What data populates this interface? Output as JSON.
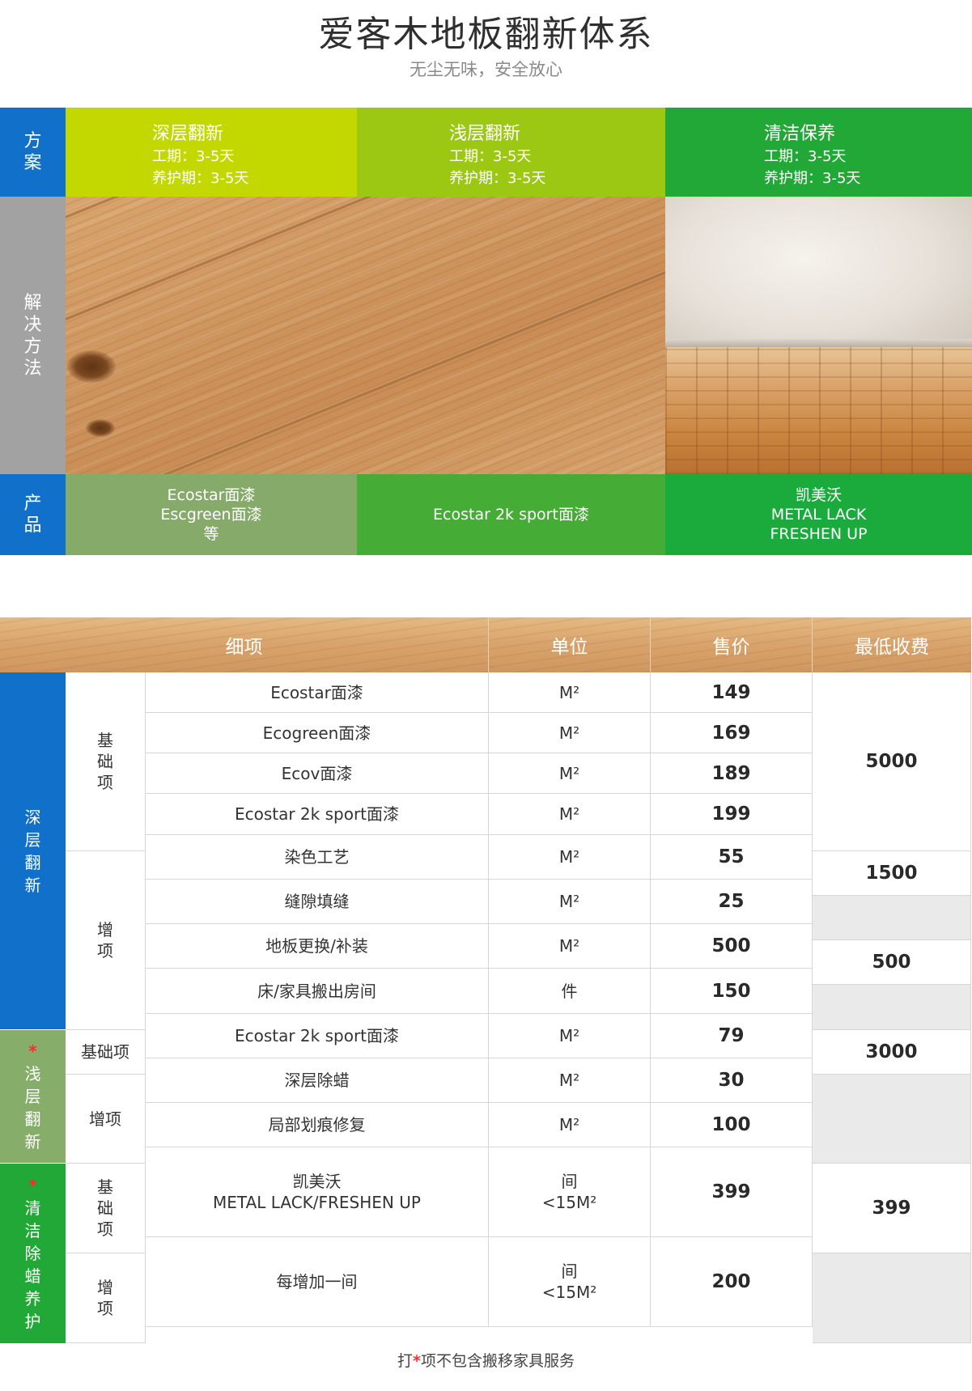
{
  "header": {
    "title": "爱客木地板翻新体系",
    "subtitle": "无尘无味，安全放心"
  },
  "scheme": {
    "labels": {
      "plan": "方案",
      "method": "解决方法",
      "product": "产品"
    },
    "plans": [
      {
        "name": "深层翻新",
        "period": "工期：3-5天",
        "care": "养护期：3-5天",
        "color": "#c2d800"
      },
      {
        "name": "浅层翻新",
        "period": "工期：3-5天",
        "care": "养护期：3-5天",
        "color": "#9cc713"
      },
      {
        "name": "清洁保养",
        "period": "工期：3-5天",
        "care": "养护期：3-5天",
        "color": "#21a836"
      }
    ],
    "products": [
      {
        "lines": [
          "Ecostar面漆",
          "Escgreen面漆",
          "等"
        ],
        "color": "#86aa6a"
      },
      {
        "lines": [
          "Ecostar 2k sport面漆"
        ],
        "color": "#45ac35"
      },
      {
        "lines": [
          "凯美沃",
          "METAL LACK",
          "FRESHEN UP"
        ],
        "color": "#1bab3c"
      }
    ],
    "label_colors": {
      "plan": "#1170c9",
      "method": "#a2a2a2",
      "product": "#1170c9"
    }
  },
  "table": {
    "headers": [
      "细项",
      "单位",
      "售价",
      "最低收费"
    ],
    "groups": [
      {
        "label": "深层翻新",
        "starred": false,
        "color": "#1170c9"
      },
      {
        "label": "浅层翻新",
        "starred": true,
        "color": "#87ad6a"
      },
      {
        "label": "清洁除蜡养护",
        "starred": true,
        "color": "#21a836"
      }
    ],
    "star": "*",
    "subgroups": {
      "deep_base": "基础项",
      "deep_add": "增项",
      "shallow_base": "基础项",
      "shallow_add": "增项",
      "clean_base": "基础项",
      "clean_add": "增项"
    },
    "rows": [
      {
        "item": "Ecostar面漆",
        "unit": "M²",
        "price": "149"
      },
      {
        "item": "Ecogreen面漆",
        "unit": "M²",
        "price": "169"
      },
      {
        "item": "Ecov面漆",
        "unit": "M²",
        "price": "189"
      },
      {
        "item": "Ecostar 2k sport面漆",
        "unit": "M²",
        "price": "199"
      },
      {
        "item": "染色工艺",
        "unit": "M²",
        "price": "55"
      },
      {
        "item": "缝隙填缝",
        "unit": "M²",
        "price": "25"
      },
      {
        "item": "地板更换/补装",
        "unit": "M²",
        "price": "500"
      },
      {
        "item": "床/家具搬出房间",
        "unit": "件",
        "price": "150"
      },
      {
        "item": "Ecostar 2k sport面漆",
        "unit": "M²",
        "price": "79"
      },
      {
        "item": "深层除蜡",
        "unit": "M²",
        "price": "30"
      },
      {
        "item": "局部划痕修复",
        "unit": "M²",
        "price": "100"
      },
      {
        "item": "凯美沃\nMETAL LACK/FRESHEN UP",
        "unit": "间\n<15M²",
        "price": "399"
      },
      {
        "item": "每增加一间",
        "unit": "间\n<15M²",
        "price": "200"
      }
    ],
    "min_charges": {
      "deep_base": "5000",
      "dyeing": "1500",
      "replace": "500",
      "shallow_base": "3000",
      "clean_base": "399"
    }
  },
  "footnote": {
    "prefix": "打",
    "star": "*",
    "suffix": "项不包含搬移家具服务"
  }
}
